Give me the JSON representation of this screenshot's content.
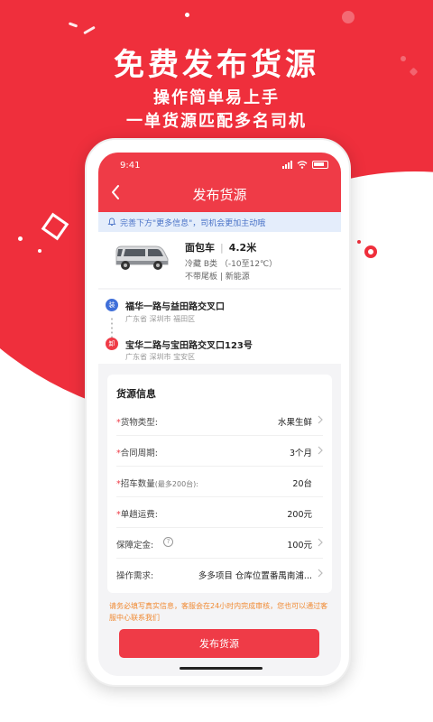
{
  "promo": {
    "title": "免费发布货源",
    "subtitle_1": "操作简单易上手",
    "subtitle_2": "一单货源匹配多名司机",
    "brand_color": "#ef2f3c"
  },
  "status_bar": {
    "time": "9:41"
  },
  "header": {
    "title": "发布货源",
    "back_icon": "chevron-left-icon"
  },
  "notice": {
    "icon": "bell-icon",
    "text": "完善下方\"更多信息\"，司机会更加主动哦"
  },
  "vehicle": {
    "name": "面包车",
    "length": "4.2米",
    "detail_1": "冷藏 B类 （-10至12℃）",
    "detail_2": "不带尾板 | 新能源"
  },
  "route": {
    "from": {
      "pin": "装",
      "address": "福华一路与益田路交叉口",
      "region": "广东省  深圳市  福田区"
    },
    "to": {
      "pin": "卸",
      "address": "宝华二路与宝田路交叉口123号",
      "region": "广东省  深圳市  宝安区"
    }
  },
  "cargo_info": {
    "title": "货源信息",
    "rows": [
      {
        "required": "*",
        "label": "货物类型:",
        "hint": "",
        "value": "水果生鲜"
      },
      {
        "required": "*",
        "label": "合同周期:",
        "hint": "",
        "value": "3个月"
      },
      {
        "required": "*",
        "label": "招车数量",
        "hint": "(最多200台):",
        "value": "20台"
      },
      {
        "required": "*",
        "label": "单趟运费:",
        "hint": "",
        "value": "200元"
      },
      {
        "required": "",
        "label": "保障定金:",
        "hint": "",
        "value": "100元"
      },
      {
        "required": "",
        "label": "操作需求:",
        "hint": "",
        "value": "多多项目 仓库位置番禺南浦..."
      }
    ]
  },
  "tip": "请务必填写真实信息，客服会在24小时内完成审核，您也可以通过客服中心联系我们",
  "submit_label": "发布货源"
}
